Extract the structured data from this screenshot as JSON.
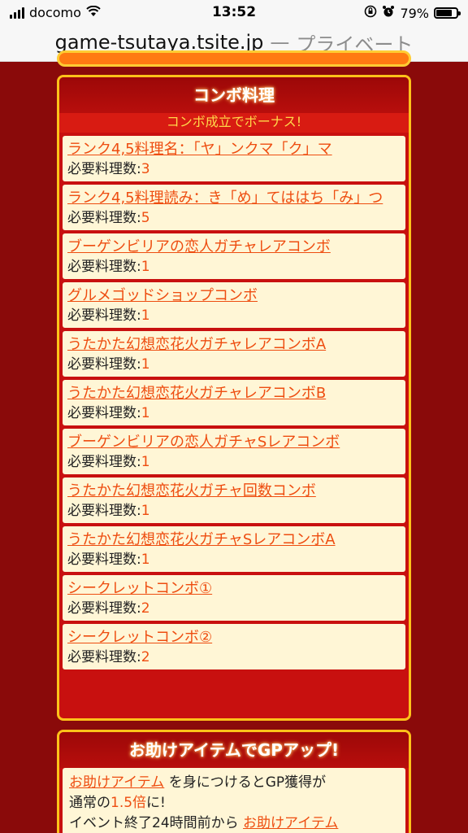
{
  "status_bar": {
    "carrier": "docomo",
    "time": "13:52",
    "battery": "79%"
  },
  "url_bar": {
    "domain": "game-tsutaya.tsite.jp",
    "separator": "—",
    "mode": "プライベート"
  },
  "combo": {
    "title": "コンボ料理",
    "subtitle": "コンボ成立でボーナス!",
    "req_label": "必要料理数:",
    "items": [
      {
        "name": "ランク4,5料理名：「ヤ」ンクマ「ク」マ",
        "count": "3"
      },
      {
        "name": "ランク4,5料理読み：き「め」てははち「み」つ",
        "count": "5"
      },
      {
        "name": "ブーゲンビリアの恋人ガチャレアコンボ",
        "count": "1"
      },
      {
        "name": "グルメゴッドショップコンボ",
        "count": "1"
      },
      {
        "name": "うたかた幻想恋花火ガチャレアコンボA",
        "count": "1"
      },
      {
        "name": "うたかた幻想恋花火ガチャレアコンボB",
        "count": "1"
      },
      {
        "name": "ブーゲンビリアの恋人ガチャSレアコンボ",
        "count": "1"
      },
      {
        "name": "うたかた幻想恋花火ガチャ回数コンボ",
        "count": "1"
      },
      {
        "name": "うたかた幻想恋花火ガチャSレアコンボA",
        "count": "1"
      },
      {
        "name": "シークレットコンボ①",
        "count": "2"
      },
      {
        "name": "シークレットコンボ②",
        "count": "2"
      }
    ]
  },
  "assist": {
    "title": "お助けアイテムでGPアップ!",
    "line1_link": "お助けアイテム",
    "line1_text": "を身につけるとGP獲得が",
    "line2_text_a": "通常の",
    "line2_highlight": "1.5倍",
    "line2_text_b": "に!",
    "line3_text": "イベント終了24時間前から",
    "line3_link": "お助けアイテム"
  },
  "colors": {
    "page_bg": "#8a0a0a",
    "panel_red": "#c8100f",
    "panel_border": "#ffc21a",
    "item_bg": "#fff6d6",
    "link_orange": "#ee4d10",
    "subtitle_yellow": "#ffd84a"
  }
}
